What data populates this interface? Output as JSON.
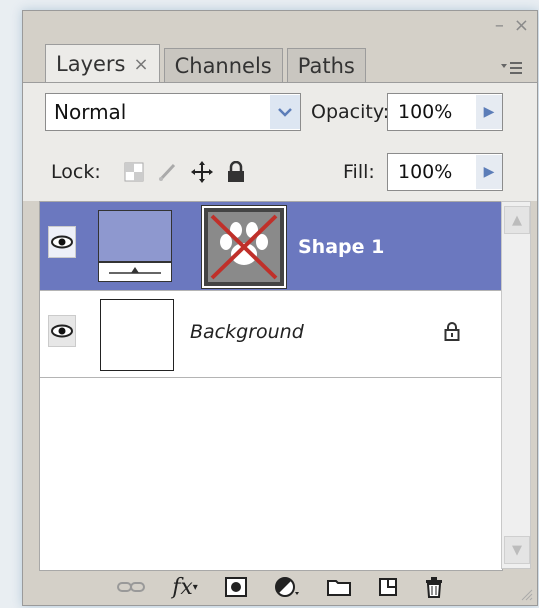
{
  "tabs": [
    {
      "label": "Layers",
      "close": "×",
      "active": true
    },
    {
      "label": "Channels",
      "active": false
    },
    {
      "label": "Paths",
      "active": false
    }
  ],
  "window_controls": {
    "minimize": "–",
    "close": "×"
  },
  "blend_mode": "Normal",
  "opacity": {
    "label": "Opacity:",
    "value": "100%"
  },
  "lock_label": "Lock:",
  "fill": {
    "label": "Fill:",
    "value": "100%"
  },
  "layers": [
    {
      "name": "Shape 1",
      "selected": true,
      "visible": true
    },
    {
      "name": "Background",
      "selected": false,
      "visible": true,
      "locked": true
    }
  ],
  "colors": {
    "selection": "#6b78bf",
    "panel": "#d4d0c8"
  }
}
